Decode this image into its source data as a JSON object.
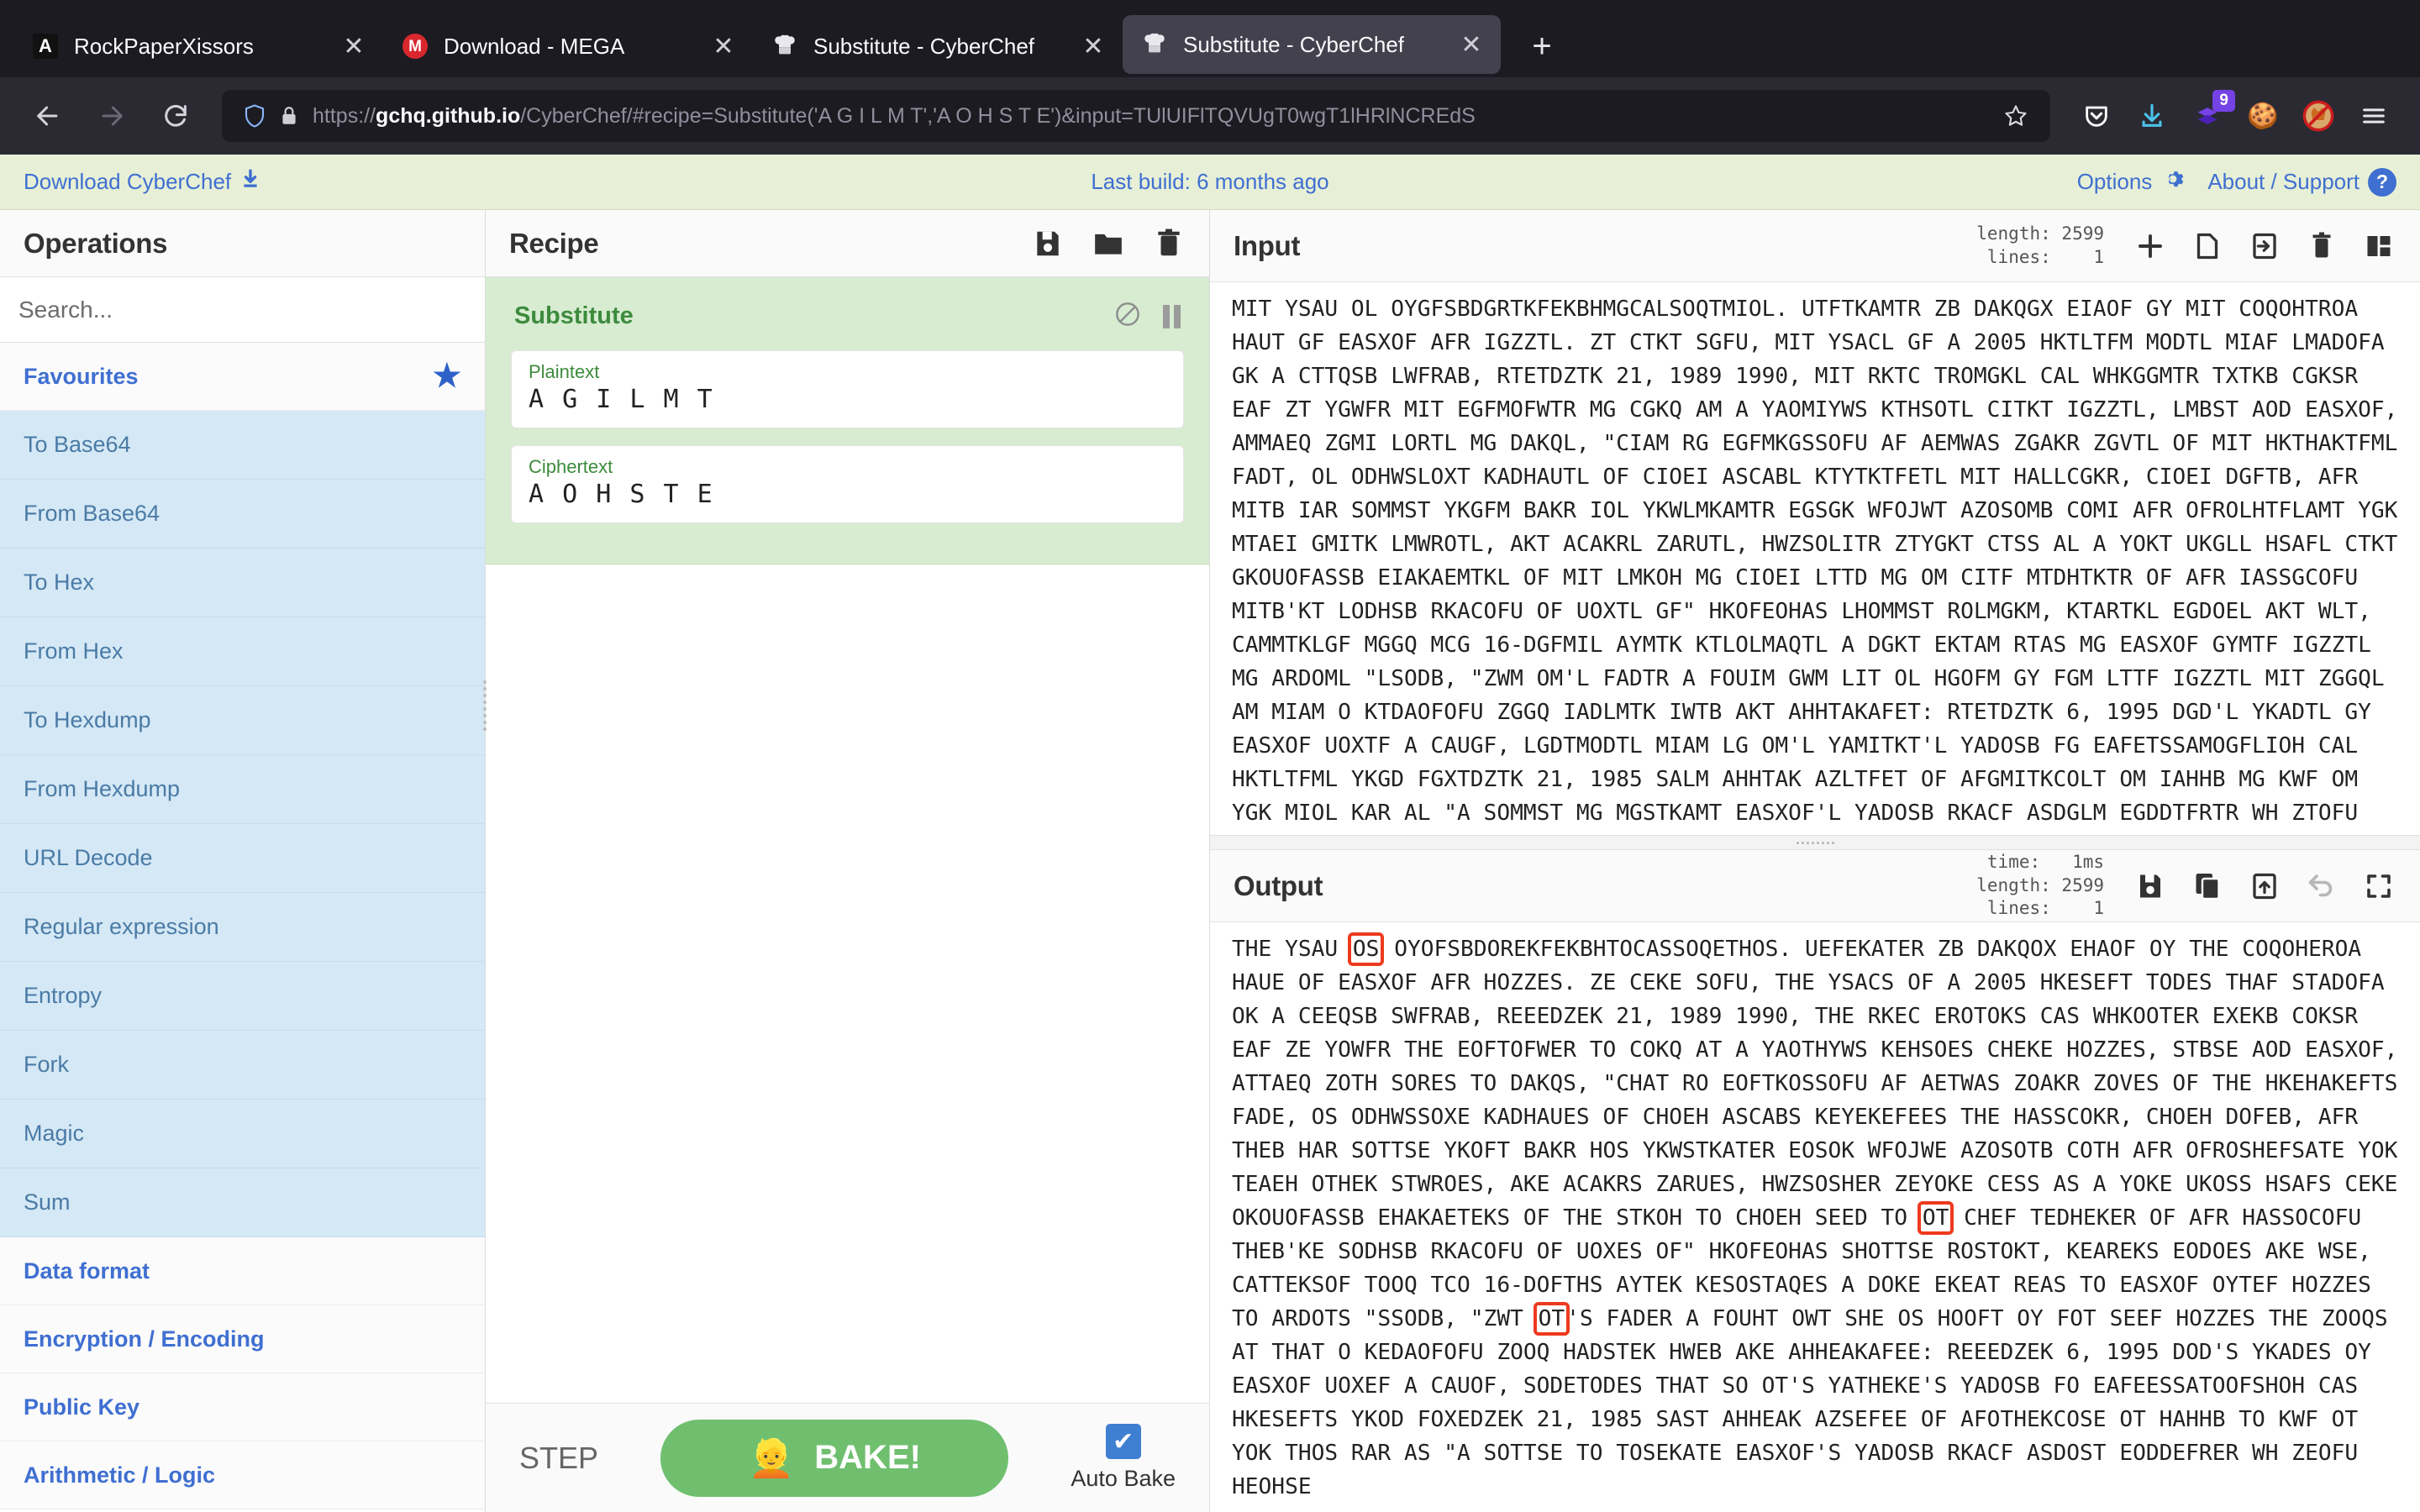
{
  "browser": {
    "tabs": [
      {
        "title": "RockPaperXissors",
        "favicon": "letter-a-icon",
        "favicon_text": "A",
        "active": false
      },
      {
        "title": "Download - MEGA",
        "favicon": "mega-icon",
        "favicon_text": "M",
        "active": false
      },
      {
        "title": "Substitute - CyberChef",
        "favicon": "chef-hat-icon",
        "favicon_text": "👩‍🍳",
        "active": false
      },
      {
        "title": "Substitute - CyberChef",
        "favicon": "chef-hat-icon",
        "favicon_text": "👩‍🍳",
        "active": true
      }
    ],
    "new_tab_label": "+",
    "close_label": "✕",
    "nav": {
      "back": "←",
      "forward": "→",
      "reload": "⟳"
    },
    "url": {
      "scheme": "https://",
      "host": "gchq.github.io",
      "path": "/CyberChef/#recipe=Substitute('A G I L M T','A O H S T E')&input=TUlUIFlTQVUgT0wgT1lHRlNCREdS",
      "full": "https://gchq.github.io/CyberChef/#recipe=Substitute('A G I L M T','A O H S T E')&input=TUlUIFlTQVUgT0wgT1lHRlNCREdS"
    },
    "toolbar_icons": [
      {
        "name": "pocket-icon",
        "glyph": "▽"
      },
      {
        "name": "downloads-icon",
        "glyph": "↓"
      },
      {
        "name": "extension-layers-icon",
        "glyph": "◆",
        "badge": "9"
      },
      {
        "name": "cookie-icon",
        "glyph": "🍪"
      },
      {
        "name": "fox-blocked-icon",
        "glyph": "🦊"
      },
      {
        "name": "hamburger-menu-icon",
        "glyph": "☰"
      }
    ],
    "accent_badge_color": "#7542e5"
  },
  "cyberchef_banner": {
    "download_label": "Download CyberChef",
    "download_icon": "download-arrow-icon",
    "last_build": "Last build: 6 months ago",
    "options_label": "Options",
    "options_icon": "gear-icon",
    "about_label": "About / Support",
    "about_icon": "question-mark-icon",
    "link_color": "#3f6fd1",
    "background": "#e7f0d6"
  },
  "operations": {
    "title": "Operations",
    "search_placeholder": "Search...",
    "search_value": "",
    "favourites_label": "Favourites",
    "favourites_star_icon": "star-icon",
    "favourite_items": [
      "To Base64",
      "From Base64",
      "To Hex",
      "From Hex",
      "To Hexdump",
      "From Hexdump",
      "URL Decode",
      "Regular expression",
      "Entropy",
      "Fork",
      "Magic",
      "Sum"
    ],
    "categories": [
      "Data format",
      "Encryption / Encoding",
      "Public Key",
      "Arithmetic / Logic"
    ]
  },
  "recipe": {
    "title": "Recipe",
    "header_icons": [
      {
        "name": "save-recipe-icon",
        "glyph": "save"
      },
      {
        "name": "load-recipe-icon",
        "glyph": "folder"
      },
      {
        "name": "clear-recipe-icon",
        "glyph": "trash"
      }
    ],
    "operation": {
      "name": "Substitute",
      "disable_icon": "disable-icon",
      "breakpoint_icon": "pause-icon",
      "args": [
        {
          "label": "Plaintext",
          "value": "A G I L M T"
        },
        {
          "label": "Ciphertext",
          "value": "A O H S T E"
        }
      ]
    },
    "step_label": "STEP",
    "bake_label": "BAKE!",
    "bake_icon": "chef-icon",
    "auto_bake_label": "Auto Bake",
    "auto_bake_checked": true,
    "bake_color": "#6fbf6f"
  },
  "input": {
    "title": "Input",
    "stats": {
      "length_label": "length:",
      "length_value": "2599",
      "lines_label": "lines:",
      "lines_value": "1"
    },
    "icons": [
      {
        "name": "add-input-tab-icon",
        "glyph": "+"
      },
      {
        "name": "open-folder-icon",
        "glyph": "folder"
      },
      {
        "name": "open-file-as-input-icon",
        "glyph": "arrow-into-box"
      },
      {
        "name": "clear-io-icon",
        "glyph": "trash"
      },
      {
        "name": "reset-pane-layout-icon",
        "glyph": "panes"
      }
    ],
    "text": "MIT YSAU OL OYGFSBDGRTKFEKBHMGCALSOQTMIOL. UTFTKAMTR ZB DAKQGX EIAOF GY MIT COQOHTROA HAUT GF EASXOF AFR IGZZTL. ZT CTKT SGFU, MIT YSACL GF A 2005 HKTLTFM MODTL MIAF LMADOFA GK A CTTQSB LWFRAB, RTETDZTK 21, 1989 1990, MIT RKTC TROMGKL CAL WHKGGMTR TXTKB CGKSR EAF ZT YGWFR MIT EGFMOFWTR MG CGKQ AM A YAOMIYWS KTHSOTL CITKT IGZZTL, LMBST AOD EASXOF, AMMAEQ ZGMI LORTL MG DAKQL, \"CIAM RG EGFMKGSSOFU AF AEMWAS ZGAKR ZGVTL OF MIT HKTHAKTFML FADT, OL ODHWSLOXT KADHAUTL OF CIOEI ASCABL KTYTKTFETL MIT HALLCGKR, CIOEI DGFTB, AFR MITB IAR SOMMST YKGFM BAKR IOL YKWLMKAMTR EGSGK WFOJWT AZOSOMB COMI AFR OFROLHTFLAMT YGK MTAEI GMITK LMWROTL, AKT ACAKRL ZARUTL, HWZSOLITR ZTYGKT CTSS AL A YOKT UKGLL HSAFL CTKT GKOUOFASSB EIAKAEMTKL OF MIT LMKOH MG CIOEI LTTD MG OM CITF MTDHTKTR OF AFR IASSGCOFU MITB'KT LODHSB RKACOFU OF UOXTL GF\" HKOFEOHAS LHOMMST ROLMGKM, KTARTKL EGDOEL AKT WLT, CAMMTKLGF MGGQ MCG 16-DGFMIL AYMTK KTLOLMAQTL A DGKT EKTAM RTAS MG EASXOF GYMTF IGZZTL MG ARDOML \"LSODB, \"ZWM OM'L FADTR A FOUIM GWM LIT OL HGOFM GY FGM LTTF IGZZTL MIT ZGGQL AM MIAM O KTDAOFOFU ZGGQ IADLMTK IWTB AKT AHHTAKAFET: RTETDZTK 6, 1995 DGD'L YKADTL GY EASXOF UOXTF A CAUGF, LGDTMODTL MIAM LG OM'L YAMITKT'L YADOSB FG EAFETSSAMOGFLIOH CAL HKTLTFML YKGD FGXTDZTK 21, 1985 SALM AHHTAK AZLTFET OF AFGMITKCOLT OM IAHHB MG KWF OM YGK MIOL KAR AL \"A SOMMST MG MGSTKAMT EASXOF'L YADOSB RKACF ASDGLM EGDDTFRTR WH ZTOFU HTGHST"
  },
  "output": {
    "title": "Output",
    "stats": {
      "time_label": "time:",
      "time_value": "1ms",
      "length_label": "length:",
      "length_value": "2599",
      "lines_label": "lines:",
      "lines_value": "1"
    },
    "icons": [
      {
        "name": "save-output-icon",
        "glyph": "save"
      },
      {
        "name": "copy-output-icon",
        "glyph": "copy"
      },
      {
        "name": "replace-input-with-output-icon",
        "glyph": "box-arrow-up"
      },
      {
        "name": "undo-bake-icon",
        "glyph": "undo"
      },
      {
        "name": "maximise-output-icon",
        "glyph": "expand"
      }
    ],
    "highlight_color": "#ee3a1e",
    "segments": [
      {
        "t": "THE YSAU ",
        "hl": false
      },
      {
        "t": "OS",
        "hl": true
      },
      {
        "t": " OYOFSBDOREKFEKBHTOCASSOQETHOS. UEFEKATER ZB DAKQOX EHAOF OY THE COQOHEROA HAUE OF EASXOF AFR HOZZES. ZE CEKE SOFU, THE YSACS OF A 2005 HKESEFT TODES THAF STADOFA OK A CEEQSB SWFRAB, REEEDZEK 21, 1989 1990, THE RKEC EROTOKS CAS WHKOOTER EXEKB COKSR EAF ZE YOWFR THE EOFTOFWER TO COKQ AT A YAOTHYWS KEHSOES CHEKE HOZZES, STBSE AOD EASXOF, ATTAEQ ZOTH SORES TO DAKQS, \"CHAT RO EOFTKOSSOFU AF AETWAS ZOAKR ZOVES OF THE HKEHAKEFTS FADE, OS ODHWSSOXE KADHAUES OF CHOEH ASCABS KEYEKEFEES THE HASSCOKR, CHOEH DOFEB, AFR THEB HAR SOTTSE YKOFT BAKR HOS YKWSTKATER EOSOK WFOJWE AZOSOTB COTH AFR OFROSHEFSATE YOK TEAEH OTHEK STWROES, AKE ACAKRS ZARUES, HWZSOSHER ZEYOKE CESS AS A YOKE UKOSS HSAFS CEKE OKOUOFASSB EHAKAETEKS OF THE STKOH TO CHOEH SEED TO ",
        "hl": false
      },
      {
        "t": "OT",
        "hl": true
      },
      {
        "t": " CHEF TEDHEKER OF AFR HASSOCOFU THEB'KE SODHSB RKACOFU OF UOXES OF\" HKOFEOHAS SHOTTSE ROSTOKT, KEAREKS EODOES AKE WSE, CATTEKSOF TOOQ TCO 16-DOFTHS AYTEK KESOSTAQES A DOKE EKEAT REAS TO EASXOF OYTEF HOZZES TO ARDOTS \"SSODB, \"ZWT ",
        "hl": false
      },
      {
        "t": "OT",
        "hl": true
      },
      {
        "t": "'S FADER A FOUHT OWT SHE OS HOOFT OY FOT SEEF HOZZES THE ZOOQS AT THAT O KEDAOFOFU ZOOQ HADSTEK HWEB AKE AHHEAKAFEE: REEEDZEK 6, 1995 DOD'S YKADES OY EASXOF UOXEF A CAUOF, SODETODES THAT SO OT'S YATHEKE'S YADOSB FO EAFEESSATOOFSHOH CAS HKESEFTS YKOD FOXEDZEK 21, 1985 SAST AHHEAK AZSEFEE OF AFOTHEKCOSE OT HAHHB TO KWF OT YOK THOS RAR AS \"A SOTTSE TO TOSEKATE EASXOF'S YADOSB RKACF ASDOST EODDEFRER WH ZEOFU HEOHSE",
        "hl": false
      }
    ]
  }
}
